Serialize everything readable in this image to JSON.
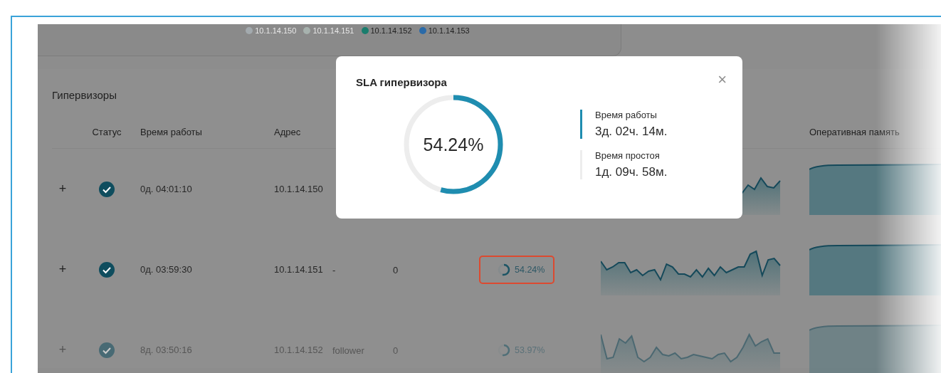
{
  "legend": [
    {
      "label": "10.1.14.150",
      "color": "#a3aaae",
      "active": false
    },
    {
      "label": "10.1.14.151",
      "color": "#a7b2ae",
      "active": false
    },
    {
      "label": "10.1.14.152",
      "color": "#1a7d6d",
      "active": true
    },
    {
      "label": "10.1.14.153",
      "color": "#2a6aa8",
      "active": true
    }
  ],
  "section": {
    "title": "Гипервизоры"
  },
  "table": {
    "columns": [
      "Статус",
      "Время работы",
      "Адрес",
      "Оперативная память"
    ],
    "rows": [
      {
        "expand": "+",
        "status_ok": true,
        "uptime": "0д. 04:01:10",
        "address": "10.1.14.150"
      },
      {
        "expand": "+",
        "status_ok": true,
        "uptime": "0д. 03:59:30",
        "address": "10.1.14.151",
        "role": "-",
        "count": "0",
        "sla": {
          "level": 0.5424,
          "reading": "54.24%",
          "highlighted": true
        }
      },
      {
        "expand": "+",
        "status_ok": true,
        "uptime": "8д. 03:50:16",
        "address": "10.1.14.152",
        "role": "follower",
        "count": "0",
        "sla": {
          "level": 0.5397,
          "reading": "53.97%",
          "highlighted": false
        }
      }
    ]
  },
  "modal": {
    "title": "SLA гипервизора",
    "close": "×",
    "level": 0.5424,
    "reading": "54.24%",
    "stats": [
      {
        "label": "Время работы",
        "value": "3д. 02ч. 14м.",
        "kind": "uptime"
      },
      {
        "label": "Время простоя",
        "value": "1д. 09ч. 58м.",
        "kind": "downtime"
      }
    ]
  }
}
